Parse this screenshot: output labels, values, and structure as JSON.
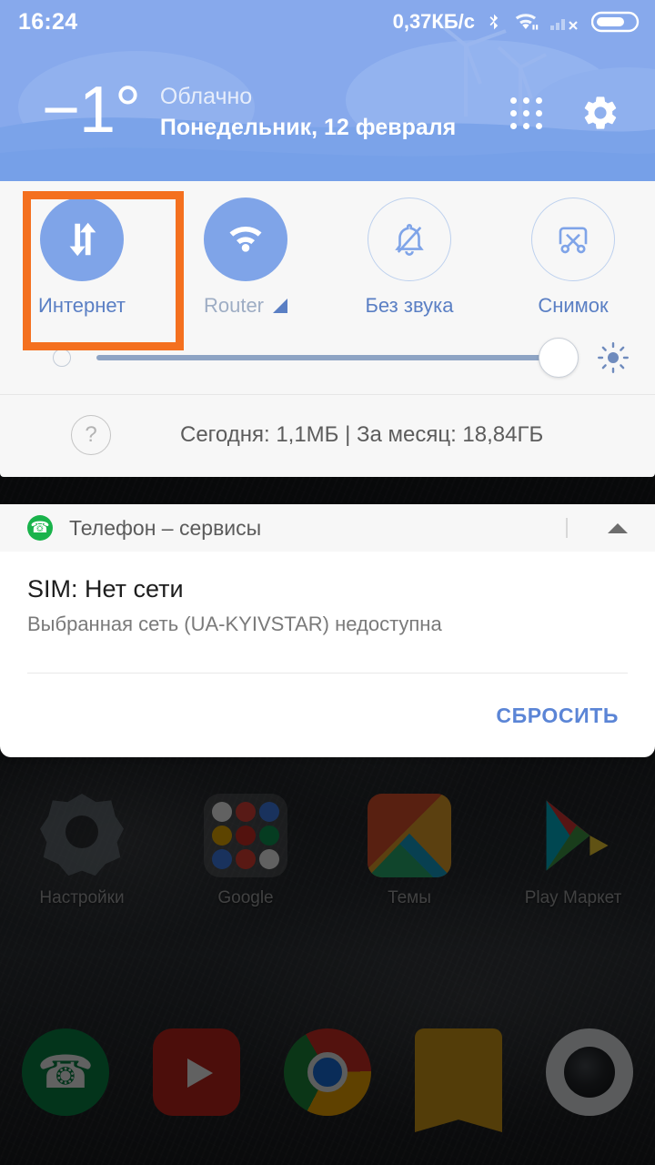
{
  "status_bar": {
    "time": "16:24",
    "net_speed": "0,37КБ/c",
    "icons": [
      "bluetooth-icon",
      "wifi-icon",
      "cellular-signal-off-icon",
      "battery-icon"
    ]
  },
  "weather_header": {
    "temperature": "−1°",
    "condition": "Облачно",
    "date": "Понедельник, 12 февраля",
    "edit_icon": "grid-dots-icon",
    "settings_icon": "gear-icon",
    "background_color": "#85a8ea"
  },
  "quick_settings": {
    "tiles": [
      {
        "label": "Интернет",
        "icon": "data-transfer-arrows-icon",
        "active": true,
        "highlighted": true
      },
      {
        "label": "Router",
        "icon": "wifi-icon",
        "active": true,
        "highlighted": false,
        "badge_icon": "signal-triangle-icon"
      },
      {
        "label": "Без звука",
        "icon": "bell-off-icon",
        "active": false,
        "highlighted": false
      },
      {
        "label": "Снимок",
        "icon": "screenshot-scissors-icon",
        "active": false,
        "highlighted": false
      }
    ],
    "highlight_color": "#f4701f",
    "active_tile_color": "#7fa4e8",
    "brightness": {
      "value_percent": 96,
      "low_icon": "brightness-low-icon",
      "high_icon": "brightness-high-sun-icon"
    },
    "data_usage": {
      "help_icon": "question-mark-icon",
      "text": "Сегодня: 1,1МБ  |  За месяц: 18,84ГБ"
    }
  },
  "notification": {
    "app_icon": "phone-icon",
    "app_name": "Телефон – сервисы",
    "collapse_icon": "chevron-up-icon",
    "title": "SIM: Нет сети",
    "subtitle": "Выбранная сеть (UA-KYIVSTAR) недоступна",
    "action_label": "СБРОСИТЬ",
    "action_color": "#5b85d6"
  },
  "home_screen": {
    "apps": [
      {
        "label": "Настройки",
        "icon": "settings-app-icon"
      },
      {
        "label": "Google",
        "icon": "google-folder-icon"
      },
      {
        "label": "Темы",
        "icon": "themes-app-icon"
      },
      {
        "label": "Play Маркет",
        "icon": "play-store-icon"
      }
    ],
    "dock": [
      {
        "icon": "phone-app-icon"
      },
      {
        "icon": "youtube-app-icon"
      },
      {
        "icon": "chrome-app-icon"
      },
      {
        "icon": "notes-app-icon"
      },
      {
        "icon": "camera-app-icon"
      }
    ]
  }
}
